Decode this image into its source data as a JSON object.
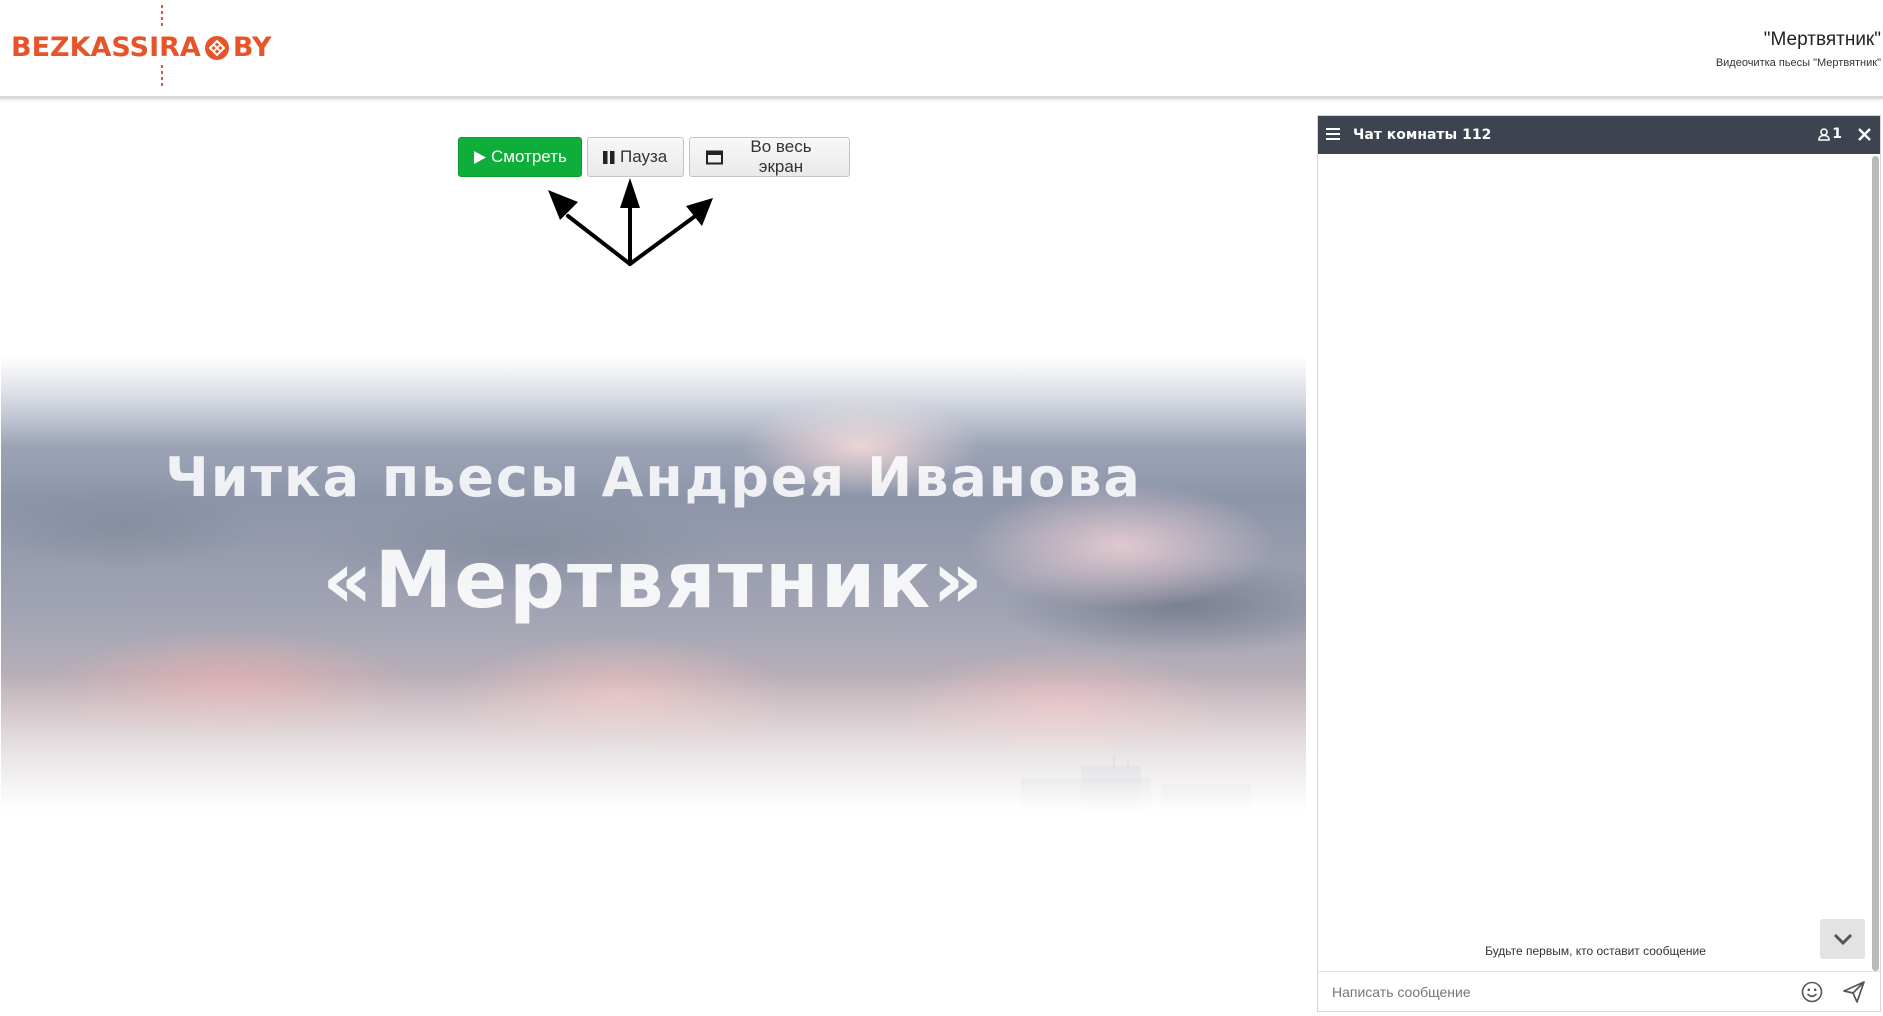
{
  "header": {
    "logo_left": "BEZKASSIRA",
    "logo_right": "BY",
    "event_title": "\"Мертвятник\"",
    "event_subtitle": "Видеочитка пьесы \"Мертвятник\""
  },
  "player": {
    "watch_label": "Смотреть",
    "pause_label": "Пауза",
    "fullscreen_label": "Во весь экран",
    "video_line1": "Читка пьесы Андрея Иванова",
    "video_line2": "«Мертвятник»"
  },
  "chat": {
    "title": "Чат комнаты 112",
    "users_count": "1",
    "empty_message": "Будьте первым, кто оставит сообщение",
    "input_placeholder": "Написать сообщение"
  },
  "colors": {
    "brand": "#e8542a",
    "play_button": "#0fae3a",
    "chat_header": "#3e4350"
  },
  "icons": {
    "play": "play-icon",
    "pause": "pause-icon",
    "fullscreen": "window-icon",
    "menu": "hamburger-icon",
    "users": "user-icon",
    "close": "close-icon",
    "scroll_down": "chevron-down-icon",
    "emoji": "smiley-icon",
    "send": "paper-plane-icon"
  }
}
